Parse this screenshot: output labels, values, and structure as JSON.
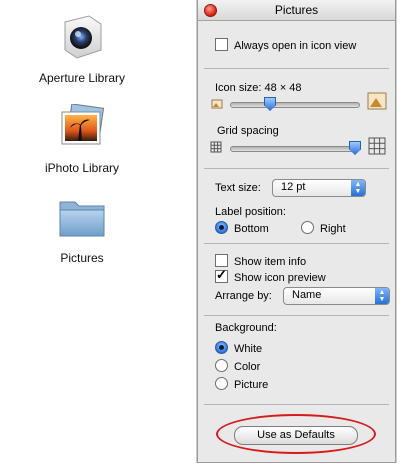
{
  "desktop": {
    "items": [
      {
        "label": "Aperture Library",
        "icon": "aperture-library-icon"
      },
      {
        "label": "iPhoto Library",
        "icon": "iphoto-library-icon"
      },
      {
        "label": "Pictures",
        "icon": "folder-icon"
      }
    ]
  },
  "panel": {
    "title": "Pictures",
    "always_open_label": "Always open in icon view",
    "always_open_checked": false,
    "icon_size_label": "Icon size: 48 × 48",
    "icon_size_value": 48,
    "grid_spacing_label": "Grid spacing",
    "text_size_label": "Text size:",
    "text_size_value": "12 pt",
    "label_position_label": "Label position:",
    "label_position_options": [
      "Bottom",
      "Right"
    ],
    "label_position_selected": "Bottom",
    "show_item_info_label": "Show item info",
    "show_item_info_checked": false,
    "show_icon_preview_label": "Show icon preview",
    "show_icon_preview_checked": true,
    "arrange_by_label": "Arrange by:",
    "arrange_by_value": "Name",
    "background_label": "Background:",
    "background_options": [
      "White",
      "Color",
      "Picture"
    ],
    "background_selected": "White",
    "defaults_button": "Use as Defaults"
  },
  "colors": {
    "annotation": "#d51b1b",
    "selection_blue": "#2a73d8"
  }
}
